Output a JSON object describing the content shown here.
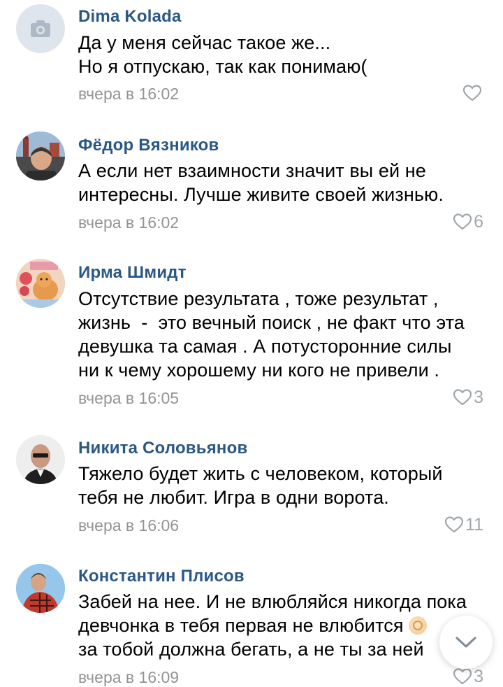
{
  "comments": [
    {
      "author": "Dima Kolada",
      "avatar": "camera-placeholder-icon",
      "lines": [
        "Да у меня сейчас такое же...",
        "Но я отпускаю, так как понимаю("
      ],
      "time": "вчера в 16:02",
      "likes": ""
    },
    {
      "author": "Фёдор Вязников",
      "avatar": "user-photo",
      "lines": [
        "А если нет взаимности значит вы ей не",
        "интересны. Лучше живите своей жизнью."
      ],
      "time": "вчера в 16:02",
      "likes": "6"
    },
    {
      "author": "Ирма Шмидт",
      "avatar": "user-photo",
      "lines": [
        "Отсутствие результата , тоже результат ,",
        "жизнь  -  это вечный поиск , не факт что эта",
        "девушка та самая . А потусторонние силы",
        "ни к чему хорошему ни кого не привели ."
      ],
      "time": "вчера в 16:05",
      "likes": "3"
    },
    {
      "author": "Никита Соловьянов",
      "avatar": "user-photo",
      "lines": [
        "Тяжело будет жить с человеком, который",
        "тебя не любит. Игра в одни ворота."
      ],
      "time": "вчера в 16:06",
      "likes": "11"
    },
    {
      "author": "Константин Плисов",
      "avatar": "user-photo",
      "lines": [
        "Забей на нее. И не влюбляйся никогда пока",
        "девчонка в тебя первая не влюбится",
        "за тобой должна бегать, а не ты за ней"
      ],
      "line2_emoji": "ok-hand-emoji",
      "time": "вчера в 16:09",
      "likes": "3"
    }
  ],
  "colors": {
    "author": "#2a5885",
    "text": "#000000",
    "meta": "#939393",
    "like_icon": "#a0a6ae"
  },
  "icons": {
    "like": "heart-outline-icon",
    "scroll": "chevron-down-icon"
  }
}
